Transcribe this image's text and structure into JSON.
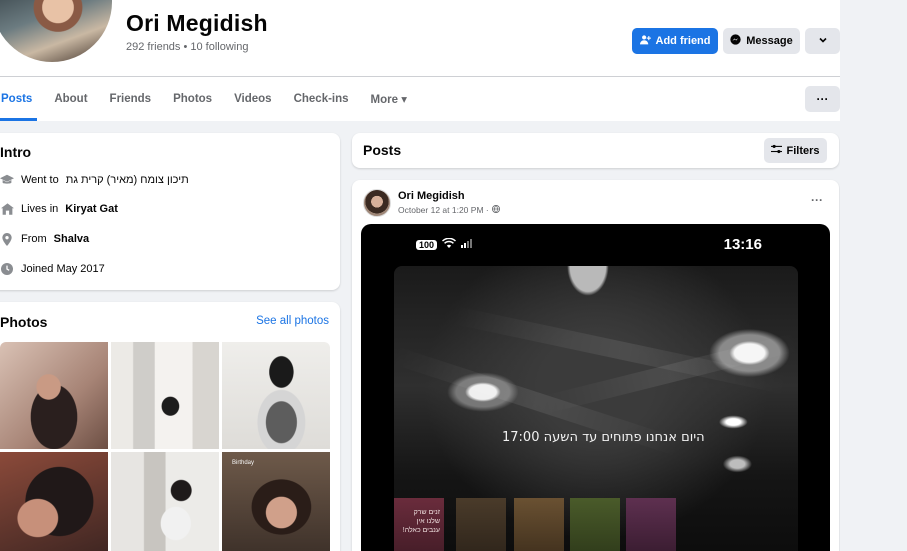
{
  "profile": {
    "name": "Ori Megidish",
    "stats": "292 friends • 10 following",
    "add_friend_label": "Add friend",
    "message_label": "Message",
    "more_caret": "⌄"
  },
  "tabs": [
    {
      "label": "Posts"
    },
    {
      "label": "About"
    },
    {
      "label": "Friends"
    },
    {
      "label": "Photos"
    },
    {
      "label": "Videos"
    },
    {
      "label": "Check-ins"
    },
    {
      "label": "More ▾"
    }
  ],
  "tab_more_dots": "···",
  "intro": {
    "title": "Intro",
    "went_to_prefix": "Went to",
    "went_to_value": "תיכון צומח (מאיר) קרית גת",
    "lives_prefix": "Lives in",
    "lives_value": "Kiryat Gat",
    "from_prefix": "From",
    "from_value": "Shalva",
    "joined": "Joined May 2017"
  },
  "photos": {
    "title": "Photos",
    "see_all": "See all photos",
    "tile6_caption": "Birthday"
  },
  "posts": {
    "title": "Posts",
    "filters_label": "Filters",
    "post": {
      "author": "Ori Megidish",
      "date": "October 12 at 1:20 PM ·",
      "more": "···",
      "phone_battery": "100",
      "phone_time": "13:16",
      "overlay_text": "היום אנחנו פתוחים עד השעה 17:00",
      "banner_text": "זנים שרק שלנו אין ענבים כאלה!"
    }
  },
  "colors": {
    "accent": "#1b74e4",
    "background": "#f0f2f5",
    "secondary_button": "#e4e6eb",
    "muted_text": "#65676b"
  },
  "icons": {
    "add_friend": "person-plus-icon",
    "message": "messenger-icon",
    "caret": "chevron-down-icon",
    "school": "graduation-cap-icon",
    "home": "house-icon",
    "location": "location-pin-icon",
    "clock": "clock-icon",
    "filters": "sliders-icon",
    "globe": "globe-icon"
  }
}
